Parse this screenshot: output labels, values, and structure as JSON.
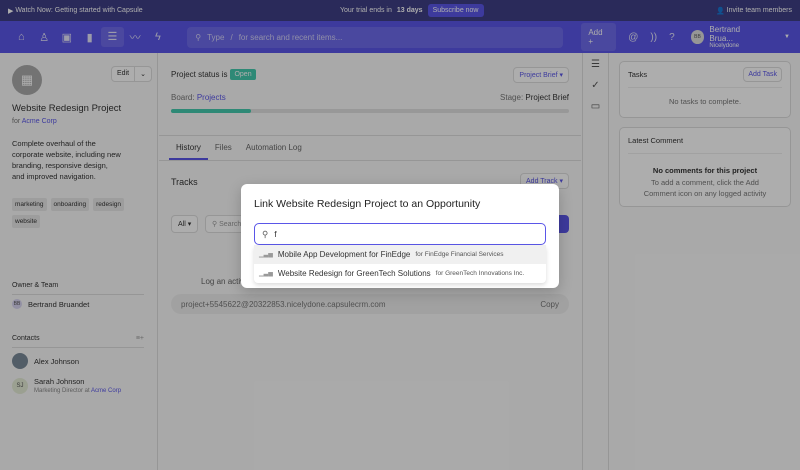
{
  "topbar": {
    "watch": "Watch Now: Getting started with Capsule",
    "trial_prefix": "Your trial ends in",
    "trial_days": "13 days",
    "subscribe": "Subscribe now",
    "invite": "Invite team members"
  },
  "nav": {
    "search_type": "Type",
    "search_slash": "/",
    "search_placeholder": "for search and recent items...",
    "add": "Add",
    "user_initials": "BB",
    "user_name": "Bertrand Brua...",
    "user_org": "Nicelydone"
  },
  "project": {
    "logo_icon": "building-icon",
    "edit": "Edit",
    "title": "Website Redesign Project",
    "for": "for",
    "company": "Acme Corp",
    "description": "Complete overhaul of the corporate website, including new branding, responsive design, and improved navigation.",
    "tags": [
      "marketing",
      "onboarding",
      "redesign",
      "website"
    ]
  },
  "owner": {
    "heading": "Owner & Team",
    "initials": "BB",
    "name": "Bertrand Bruandet"
  },
  "contacts": {
    "heading": "Contacts",
    "items": [
      {
        "name": "Alex Johnson"
      },
      {
        "initials": "SJ",
        "name": "Sarah Johnson",
        "role": "Marketing Director at",
        "company": "Acme Corp"
      }
    ]
  },
  "main": {
    "status_label": "Project status is",
    "status": "Open",
    "brief": "Project Brief",
    "board_label": "Board:",
    "board": "Projects",
    "stage_label": "Stage:",
    "stage": "Project Brief",
    "progress": 0.2,
    "tabs": [
      "History",
      "Files",
      "Automation Log"
    ],
    "tracks": "Tracks",
    "add_track": "Add Track",
    "filter": "All",
    "search": "Search",
    "log_text": "Log an activity",
    "email": "project+5545622@20322853.nicelydone.capsulecrm.com",
    "copy": "Copy"
  },
  "tasks": {
    "heading": "Tasks",
    "add": "Add Task",
    "empty": "No tasks to complete."
  },
  "comment": {
    "heading": "Latest Comment",
    "empty_title": "No comments for this project",
    "empty_text": "To add a comment, click the Add Comment icon on any logged activity"
  },
  "modal": {
    "title": "Link Website Redesign Project to an Opportunity",
    "query": "f",
    "options": [
      {
        "name": "Mobile App Development for FinEdge",
        "for": "for FinEdge Financial Services"
      },
      {
        "name": "Website Redesign for GreenTech Solutions",
        "for": "for GreenTech Innovations Inc."
      }
    ]
  },
  "colors": {
    "accent": "#5a56e8",
    "open": "#44cbae"
  }
}
